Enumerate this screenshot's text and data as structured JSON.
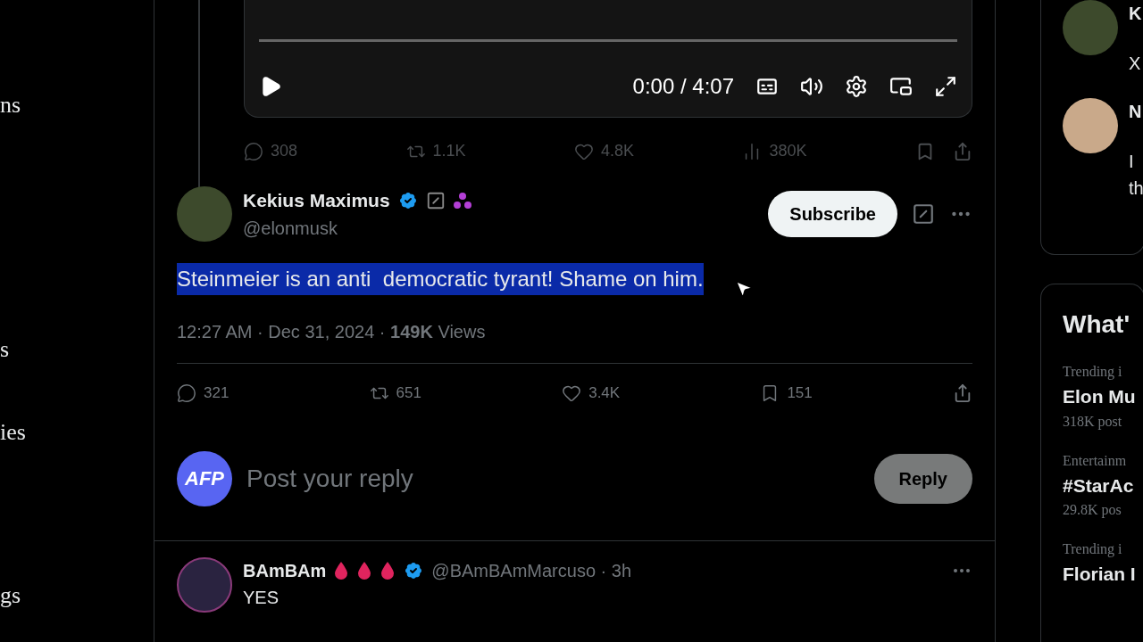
{
  "sidebar": {
    "items": [
      {
        "label": "ns"
      },
      {
        "label": "s"
      },
      {
        "label": "ies"
      },
      {
        "label": "gs"
      }
    ]
  },
  "video": {
    "time": "0:00 / 4:07"
  },
  "parent_actions": [
    {
      "kind": "reply",
      "count": "308"
    },
    {
      "kind": "repost",
      "count": "1.1K"
    },
    {
      "kind": "like",
      "count": "4.8K"
    },
    {
      "kind": "views",
      "count": "380K"
    }
  ],
  "post": {
    "name": "Kekius Maximus",
    "handle": "@elonmusk",
    "subscribe": "Subscribe",
    "text": "Steinmeier is an anti  democratic tyrant! Shame on him.",
    "selected": true,
    "meta": "12:27 AM · Dec 31, 2024 · **149K** Views"
  },
  "post_actions": [
    {
      "kind": "reply",
      "count": "321"
    },
    {
      "kind": "repost",
      "count": "651"
    },
    {
      "kind": "like",
      "count": "3.4K"
    },
    {
      "kind": "bookmark",
      "count": "151"
    }
  ],
  "composer": {
    "avatar": "AFP",
    "placeholder": "Post your reply",
    "button": "Reply",
    "disabled": true
  },
  "reply": {
    "name": "BAmBAm",
    "handle": "@BAmBAmMarcuso · 3h",
    "text": "YES"
  },
  "right": {
    "users": [
      {
        "name": "K",
        "bio": [
          "X"
        ]
      },
      {
        "name": "N",
        "bio": [
          "I",
          "th"
        ]
      }
    ],
    "trends_title": "What'",
    "trends": [
      {
        "context": "Trending i",
        "title": "Elon Mu",
        "count": "318K post"
      },
      {
        "context": "Entertainm",
        "title": "#StarAc",
        "count": "29.8K pos"
      },
      {
        "context": "Trending i",
        "title": "Florian I"
      }
    ]
  }
}
